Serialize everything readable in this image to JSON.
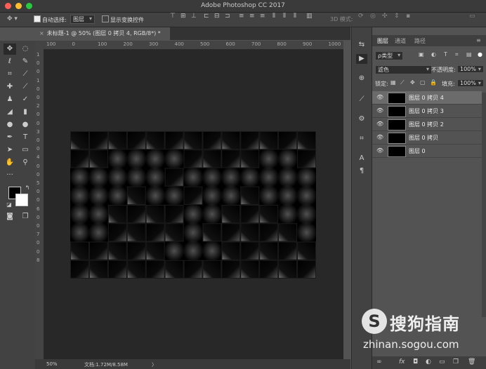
{
  "window": {
    "title": "Adobe Photoshop CC 2017"
  },
  "options": {
    "auto_select_label": "自动选择:",
    "auto_select_value": "图层",
    "transform_controls_label": "显示变换控件",
    "mode_3d_label": "3D 模式:"
  },
  "tab": {
    "label": "未标题-1 @ 50% (图层 0 拷贝 4, RGB/8*) *",
    "close": "×"
  },
  "ruler": {
    "h": [
      "100",
      "0",
      "100",
      "200",
      "300",
      "400",
      "500",
      "600",
      "700",
      "800",
      "900",
      "1000"
    ],
    "v": [
      "1",
      "0",
      "0",
      "1",
      "0",
      "0",
      "2",
      "0",
      "0",
      "3",
      "0",
      "0",
      "4",
      "0",
      "0",
      "5",
      "0",
      "0",
      "6",
      "0",
      "0",
      "7",
      "0",
      "0",
      "8"
    ]
  },
  "status": {
    "zoom": "50%",
    "doc": "文档:1.72M/8.58M",
    "arrow": "〉"
  },
  "panel": {
    "tabs": [
      "图层",
      "通道",
      "路径"
    ],
    "filter_kind": "ρ类型",
    "blend_mode": "滤色",
    "opacity_label": "不透明度:",
    "opacity_value": "100%",
    "lock_label": "锁定:",
    "fill_label": "填充:",
    "fill_value": "100%",
    "layers": [
      {
        "name": "图层 0 拷贝 4",
        "selected": true
      },
      {
        "name": "图层 0 拷贝 3",
        "selected": false
      },
      {
        "name": "图层 0 拷贝 2",
        "selected": false
      },
      {
        "name": "图层 0 拷贝",
        "selected": false
      },
      {
        "name": "图层 0",
        "selected": false
      }
    ],
    "bottom_icons": [
      "∞",
      "fx",
      "◘",
      "◐",
      "▭",
      "❐",
      "🗑"
    ]
  },
  "watermark": {
    "logo": "S",
    "cn": "搜狗指南",
    "url": "zhinan.sogou.com"
  },
  "colors": {
    "close": "#ff5f56",
    "minimize": "#ffbd2e",
    "zoom": "#27c93f"
  }
}
